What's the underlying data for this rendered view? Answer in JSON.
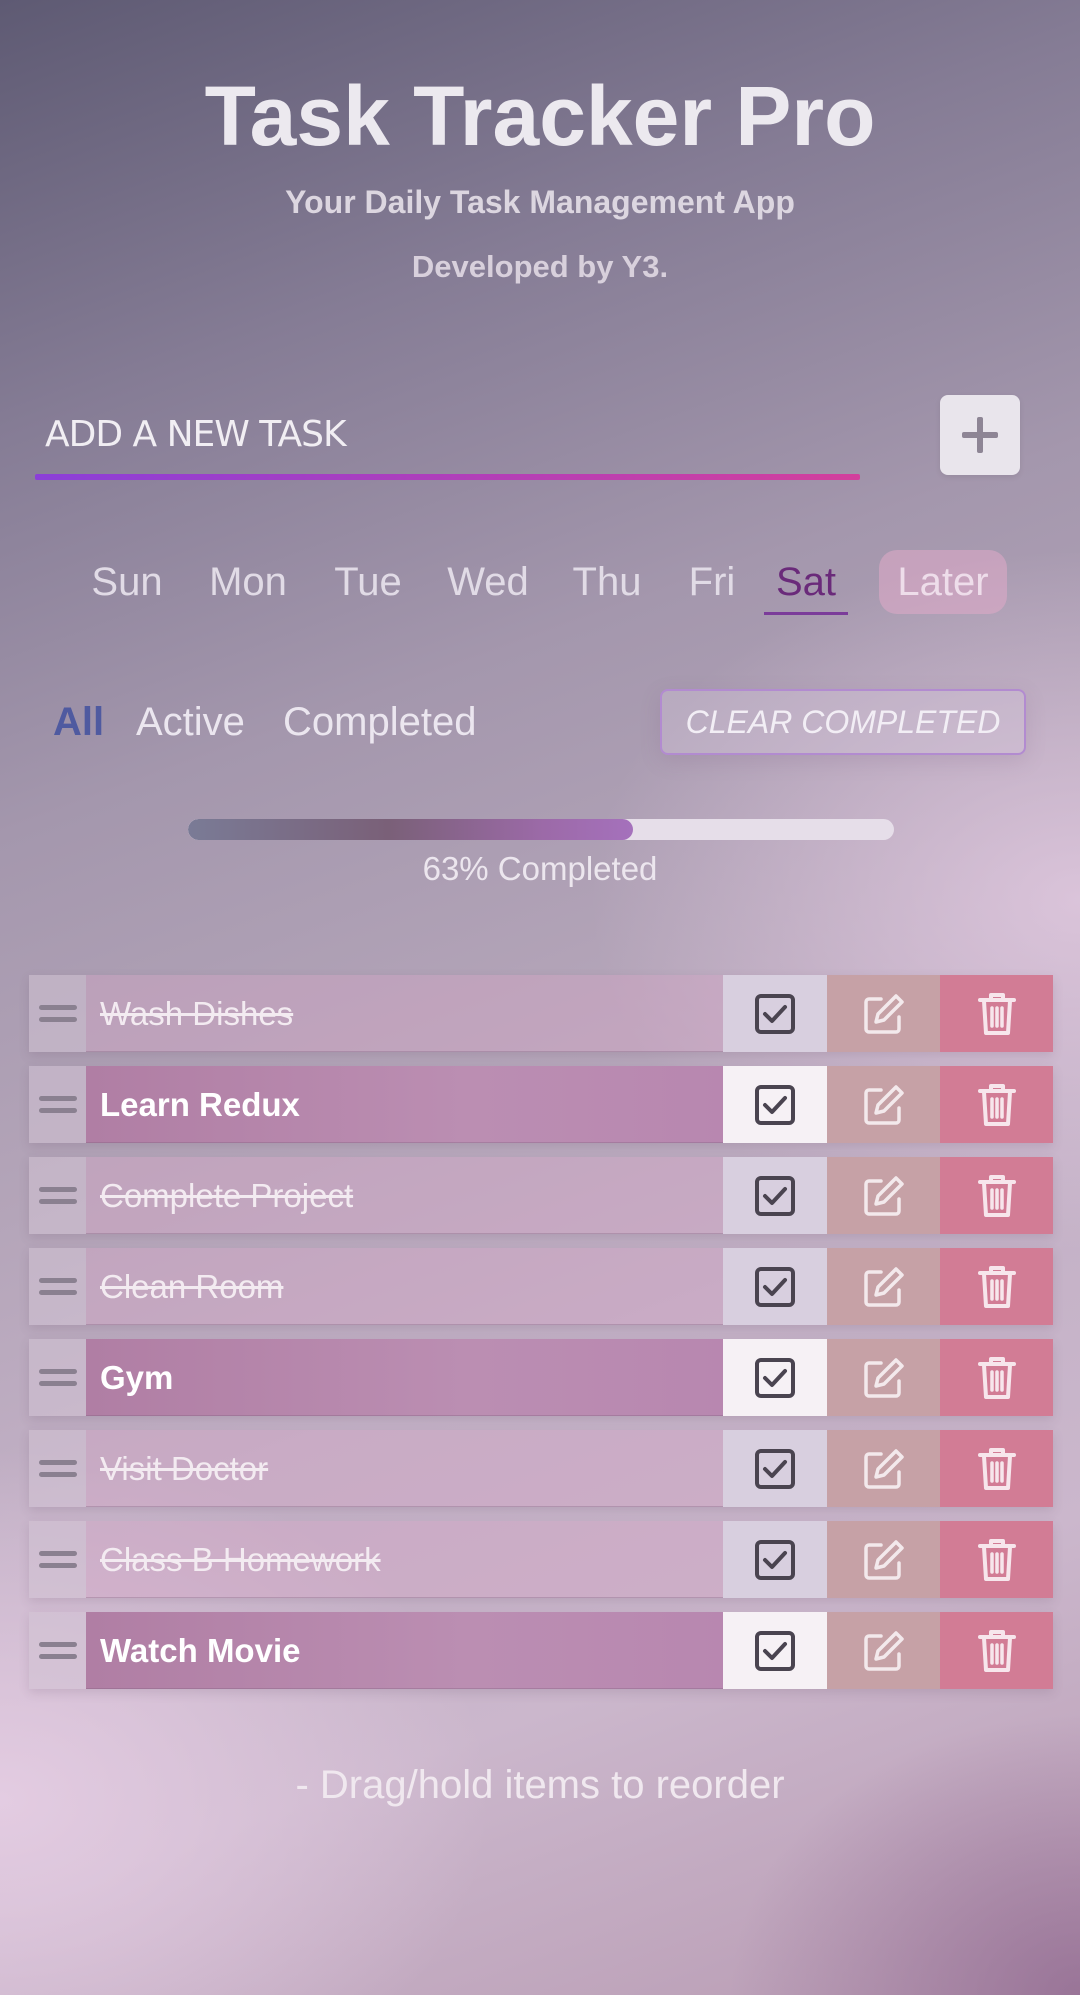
{
  "header": {
    "title": "Task Tracker Pro",
    "subtitle": "Your Daily Task Management App",
    "developer": "Developed by Y3."
  },
  "add_task": {
    "placeholder": "ADD A NEW TASK",
    "value": "",
    "button_icon": "plus-icon"
  },
  "days": {
    "items": [
      "Sun",
      "Mon",
      "Tue",
      "Wed",
      "Thu",
      "Fri",
      "Sat"
    ],
    "selected": "Sat",
    "later": "Later"
  },
  "filters": {
    "all": "All",
    "active": "Active",
    "completed": "Completed",
    "selected": "All",
    "clear_completed": "CLEAR COMPLETED"
  },
  "progress": {
    "percent": 63,
    "label": "63% Completed"
  },
  "tasks": [
    {
      "label": "Wash Dishes",
      "completed": true
    },
    {
      "label": "Learn Redux",
      "completed": false
    },
    {
      "label": "Complete Project",
      "completed": true
    },
    {
      "label": "Clean Room",
      "completed": true
    },
    {
      "label": "Gym",
      "completed": false
    },
    {
      "label": "Visit Doctor",
      "completed": true
    },
    {
      "label": "Class B Homework",
      "completed": true
    },
    {
      "label": "Watch Movie",
      "completed": false
    }
  ],
  "icons": {
    "drag": "drag-handle-icon",
    "check": "checkbox-icon",
    "edit": "edit-icon",
    "delete": "trash-icon"
  },
  "hint": "- Drag/hold items to reorder",
  "colors": {
    "accent_purple": "#8b3fd8",
    "accent_pink": "#d33f9c",
    "active_day": "#6a2a7a",
    "active_filter": "#4f5aa0",
    "delete_red": "#d27c95"
  }
}
